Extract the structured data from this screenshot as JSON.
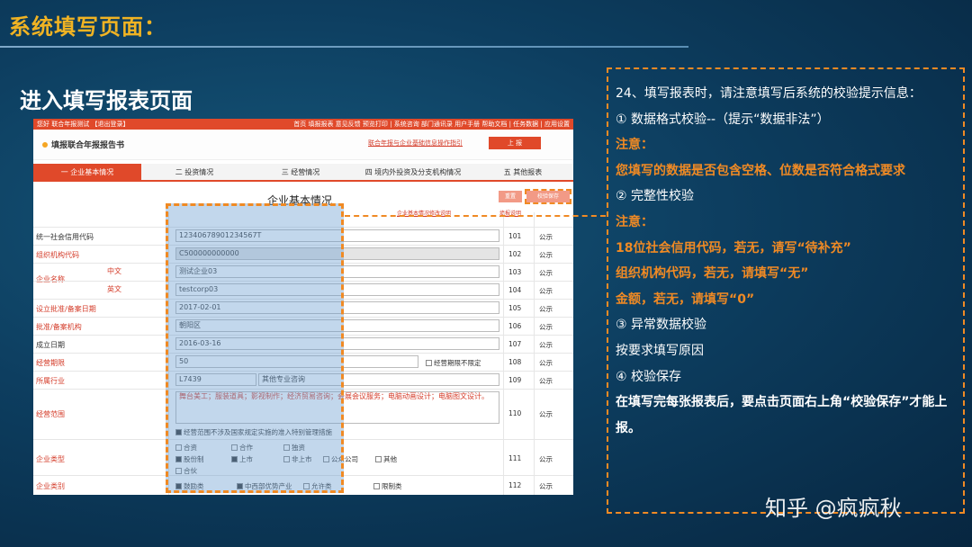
{
  "slide": {
    "title": "系统填写页面：",
    "subtitle": "进入填写报表页面",
    "watermark": "知乎 @疯疯秋"
  },
  "form": {
    "topbar_left": "您好 联合年报测试  【退出登录】",
    "topbar_right": "首页 填报报表 意见反馈 预览打印 | 系统咨询 部门通讯录 用户手册 帮助文档 | 任务数据 | 应用设置",
    "header_title": "填报联合年报报告书",
    "header_link": "联合年报与企业基础信息操作指引",
    "header_button": "上 报",
    "tabs": [
      "一 企业基本情况",
      "二 投资情况",
      "三 经营情况",
      "四 境内外投资及分支机构情况",
      "五 其他报表"
    ],
    "section_heading": "企业基本情况",
    "btn_reset": "重置",
    "btn_verify_save": "校验保存",
    "link_1": "企业基本情况修改说明",
    "link_2": "填报说明",
    "rows": [
      {
        "label": "统一社会信用代码",
        "value": "12340678901234567T",
        "code": "101",
        "pub": "公示"
      },
      {
        "label": "组织机构代码",
        "value": "C500000000000",
        "code": "102",
        "pub": "公示"
      },
      {
        "label": "企业名称",
        "sublabel": "中文",
        "value": "测试企业03",
        "code": "103",
        "pub": "公示"
      },
      {
        "label": "",
        "sublabel": "英文",
        "value": "testcorp03",
        "code": "104",
        "pub": "公示"
      },
      {
        "label": "设立批准/备案日期",
        "value": "2017-02-01",
        "code": "105",
        "pub": "公示"
      },
      {
        "label": "批准/备案机构",
        "value": "朝阳区",
        "code": "106",
        "pub": "公示"
      },
      {
        "label": "成立日期",
        "value": "2016-03-16",
        "code": "107",
        "pub": "公示"
      },
      {
        "label": "经营期限",
        "value": "50",
        "code": "108",
        "pub": "公示"
      },
      {
        "label": "所属行业",
        "value": "L7439",
        "code": "109",
        "pub": "公示"
      },
      {
        "label": "经营范围",
        "value": "舞台美工；服装道具；影视制作；经济贸易咨询；会展会议服务；电脑动画设计；电脑图文设计。",
        "code": "110",
        "pub": "公示"
      },
      {
        "label": "企业类型",
        "value": "",
        "code": "111",
        "pub": "公示"
      },
      {
        "label": "企业类别",
        "value": "",
        "code": "112",
        "pub": "公示"
      }
    ],
    "industry_name": "其他专业咨询",
    "no_limit_label": "经营期限不限定",
    "scope_checkbox_label": "经营范围不涉及国家规定实施的准入特别管理措施",
    "type_options": [
      "合资",
      "合作",
      "独资",
      "股份制",
      "上市",
      "非上市",
      "公众公司",
      "其他",
      "合伙"
    ],
    "category_options": [
      "鼓励类",
      "中西部优势产业",
      "允许类",
      "限制类"
    ]
  },
  "panel": {
    "p1": "24、填写报表时，请注意填写后系统的校验提示信息：",
    "h1": "①   数据格式校验--（提示“数据非法”）",
    "n1": "注意：",
    "n1_body": "您填写的数据是否包含空格、位数是否符合格式要求",
    "h2": "②  完整性校验",
    "n2": "注意：",
    "n2_a": "18位社会信用代码，若无，请写“待补充”",
    "n2_b": "组织机构代码，若无，请填写“无”",
    "n2_c": "金额，若无，请填写“0”",
    "h3": "③  异常数据校验",
    "h3_body": "按要求填写原因",
    "h4": "④   校验保存",
    "h4_body": "在填写完每张报表后，要点击页面右上角“校验保存”才能上报。"
  },
  "colors": {
    "title_yellow": "#f0b323",
    "accent_orange": "#f08a24",
    "form_red": "#e0492a"
  }
}
